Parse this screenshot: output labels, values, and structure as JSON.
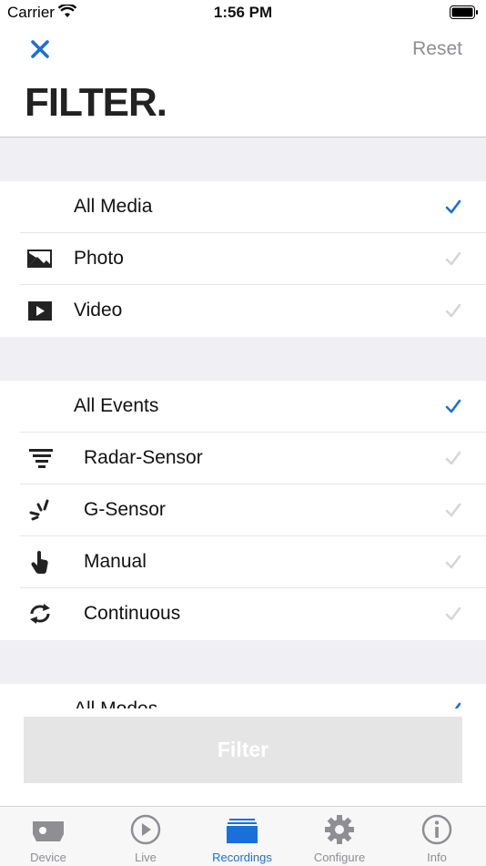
{
  "status_bar": {
    "carrier": "Carrier",
    "time": "1:56 PM"
  },
  "header": {
    "title": "FILTER.",
    "reset_label": "Reset"
  },
  "colors": {
    "accent": "#1a6fd8",
    "inactive_check": "#d6d6d6",
    "section_gap": "#efeff4"
  },
  "media": {
    "items": [
      {
        "label": "All Media",
        "icon": null,
        "checked": true
      },
      {
        "label": "Photo",
        "icon": "photo-icon",
        "checked": false
      },
      {
        "label": "Video",
        "icon": "video-play-icon",
        "checked": false
      }
    ]
  },
  "events": {
    "items": [
      {
        "label": "All Events",
        "icon": null,
        "checked": true
      },
      {
        "label": "Radar-Sensor",
        "icon": "radar-sensor-icon",
        "checked": false
      },
      {
        "label": "G-Sensor",
        "icon": "g-sensor-icon",
        "checked": false
      },
      {
        "label": "Manual",
        "icon": "hand-pointer-icon",
        "checked": false
      },
      {
        "label": "Continuous",
        "icon": "loop-arrows-icon",
        "checked": false
      }
    ]
  },
  "modes": {
    "items": [
      {
        "label": "All Modes",
        "checked": true
      }
    ]
  },
  "filter_button": {
    "label": "Filter"
  },
  "tab_bar": {
    "tabs": [
      {
        "label": "Device",
        "icon": "camera-device-icon",
        "active": false
      },
      {
        "label": "Live",
        "icon": "play-circle-icon",
        "active": false
      },
      {
        "label": "Recordings",
        "icon": "recordings-stack-icon",
        "active": true
      },
      {
        "label": "Configure",
        "icon": "gear-icon",
        "active": false
      },
      {
        "label": "Info",
        "icon": "info-circle-icon",
        "active": false
      }
    ]
  }
}
